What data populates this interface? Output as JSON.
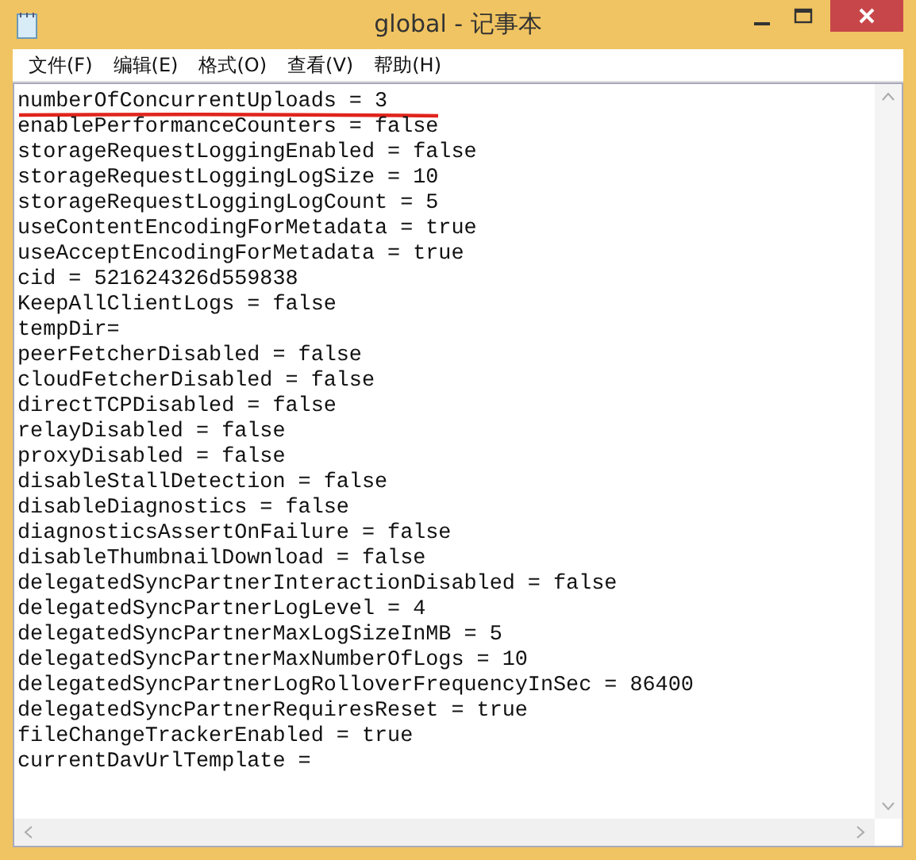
{
  "window": {
    "title": "global - 记事本"
  },
  "menu": [
    "文件(F)",
    "编辑(E)",
    "格式(O)",
    "查看(V)",
    "帮助(H)"
  ],
  "document": {
    "lines": [
      {
        "text": "numberOfConcurrentUploads = 3",
        "underlined": true
      },
      {
        "text": "enablePerformanceCounters = false",
        "underlined": false
      },
      {
        "text": "storageRequestLoggingEnabled = false",
        "underlined": false
      },
      {
        "text": "storageRequestLoggingLogSize = 10",
        "underlined": false
      },
      {
        "text": "storageRequestLoggingLogCount = 5",
        "underlined": false
      },
      {
        "text": "useContentEncodingForMetadata = true",
        "underlined": false
      },
      {
        "text": "useAcceptEncodingForMetadata = true",
        "underlined": false
      },
      {
        "text": "cid = 521624326d559838",
        "underlined": false
      },
      {
        "text": "KeepAllClientLogs = false",
        "underlined": false
      },
      {
        "text": "tempDir=",
        "underlined": false
      },
      {
        "text": "peerFetcherDisabled = false",
        "underlined": false
      },
      {
        "text": "cloudFetcherDisabled = false",
        "underlined": false
      },
      {
        "text": "directTCPDisabled = false",
        "underlined": false
      },
      {
        "text": "relayDisabled = false",
        "underlined": false
      },
      {
        "text": "proxyDisabled = false",
        "underlined": false
      },
      {
        "text": "disableStallDetection = false",
        "underlined": false
      },
      {
        "text": "disableDiagnostics = false",
        "underlined": false
      },
      {
        "text": "diagnosticsAssertOnFailure = false",
        "underlined": false
      },
      {
        "text": "disableThumbnailDownload = false",
        "underlined": false
      },
      {
        "text": "delegatedSyncPartnerInteractionDisabled = false",
        "underlined": false
      },
      {
        "text": "delegatedSyncPartnerLogLevel = 4",
        "underlined": false
      },
      {
        "text": "delegatedSyncPartnerMaxLogSizeInMB = 5",
        "underlined": false
      },
      {
        "text": "delegatedSyncPartnerMaxNumberOfLogs = 10",
        "underlined": false
      },
      {
        "text": "delegatedSyncPartnerLogRolloverFrequencyInSec = 86400",
        "underlined": false
      },
      {
        "text": "delegatedSyncPartnerRequiresReset = true",
        "underlined": false
      },
      {
        "text": "fileChangeTrackerEnabled = true",
        "underlined": false
      },
      {
        "text": "currentDavUrlTemplate =",
        "underlined": false
      }
    ]
  }
}
